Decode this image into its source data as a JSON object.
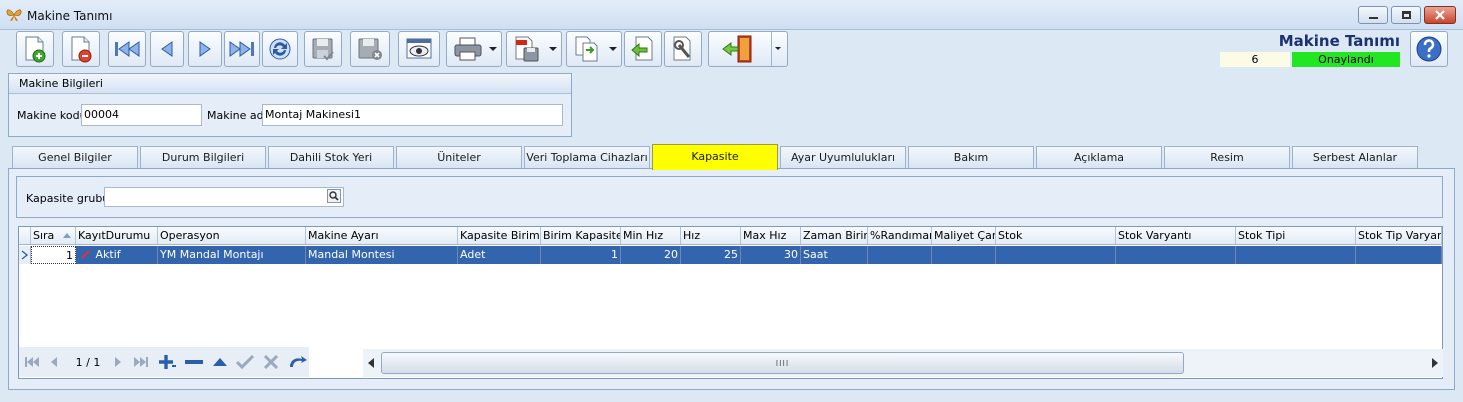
{
  "window": {
    "title": "Makine Tanımı"
  },
  "toolbar": {
    "buttons": [
      {
        "name": "new-record",
        "icon": "new-document-icon"
      },
      {
        "name": "delete-record",
        "icon": "delete-document-icon"
      },
      {
        "name": "first-record",
        "icon": "first-icon"
      },
      {
        "name": "prev-record",
        "icon": "prev-icon"
      },
      {
        "name": "next-record",
        "icon": "next-icon"
      },
      {
        "name": "last-record",
        "icon": "last-icon"
      },
      {
        "name": "refresh",
        "icon": "refresh-icon"
      },
      {
        "name": "save",
        "icon": "save-icon"
      },
      {
        "name": "save-close",
        "icon": "save-close-icon"
      },
      {
        "name": "preview",
        "icon": "preview-icon"
      },
      {
        "name": "print",
        "icon": "printer-icon"
      },
      {
        "name": "export-pdf",
        "icon": "pdf-icon"
      },
      {
        "name": "copy",
        "icon": "copy-icon"
      },
      {
        "name": "import",
        "icon": "import-icon"
      },
      {
        "name": "settings",
        "icon": "tools-icon"
      },
      {
        "name": "exit",
        "icon": "exit-door-icon"
      }
    ]
  },
  "header": {
    "form_title": "Makine Tanımı",
    "record_count": "6",
    "status": "Onaylandı",
    "status_color": "#22e622"
  },
  "machine_info": {
    "group_title": "Makine Bilgileri",
    "code_label": "Makine kodu",
    "code_value": "00004",
    "name_label": "Makine adı",
    "name_value": "Montaj Makinesi1"
  },
  "tabs": [
    {
      "label": "Genel Bilgiler"
    },
    {
      "label": "Durum Bilgileri"
    },
    {
      "label": "Dahili Stok Yeri"
    },
    {
      "label": "Üniteler"
    },
    {
      "label": "Veri Toplama Cihazları"
    },
    {
      "label": "Kapasite",
      "active": true
    },
    {
      "label": "Ayar Uyumlulukları"
    },
    {
      "label": "Bakım"
    },
    {
      "label": "Açıklama"
    },
    {
      "label": "Resim"
    },
    {
      "label": "Serbest Alanlar"
    }
  ],
  "capacity": {
    "group_label": "Kapasite grubu",
    "group_value": ""
  },
  "grid": {
    "columns": [
      "Sıra",
      "KayıtDurumu",
      "Operasyon",
      "Makine Ayarı",
      "Kapasite Birimi",
      "Birim Kapasite",
      "Min Hız",
      "Hız",
      "Max Hız",
      "Zaman Birimi",
      "%Randıman",
      "Maliyet Çarp",
      "Stok",
      "Stok Varyantı",
      "Stok Tipi",
      "Stok Tip Varyantı"
    ],
    "rows": [
      [
        "1",
        "Aktif",
        "YM Mandal Montajı",
        "Mandal Montesi",
        "Adet",
        "1",
        "20",
        "25",
        "30",
        "Saat",
        "",
        "",
        "",
        "",
        "",
        ""
      ]
    ],
    "selection_color": "#3265ad",
    "navigator": {
      "page_text": "1 / 1"
    },
    "scroll_thumb_text": "IIII"
  }
}
